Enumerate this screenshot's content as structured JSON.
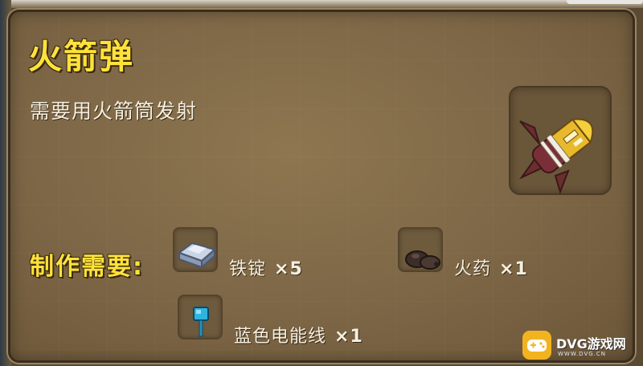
{
  "item": {
    "name": "火箭弹",
    "description": "需要用火箭筒发射",
    "icon": "rocket-shell-icon"
  },
  "recipe": {
    "label": "制作需要:",
    "materials": [
      {
        "name": "铁锭",
        "qty": "×5",
        "icon": "iron-ingot-icon"
      },
      {
        "name": "火药",
        "qty": "×1",
        "icon": "gunpowder-icon"
      },
      {
        "name": "蓝色电能线",
        "qty": "×1",
        "icon": "blue-wire-icon"
      }
    ]
  },
  "watermark": {
    "brand": "DVG游戏网",
    "url": "WWW.DVG.CN"
  },
  "colors": {
    "title": "#ffe23a",
    "panel": "#7d6646",
    "text": "#f4efe2"
  }
}
